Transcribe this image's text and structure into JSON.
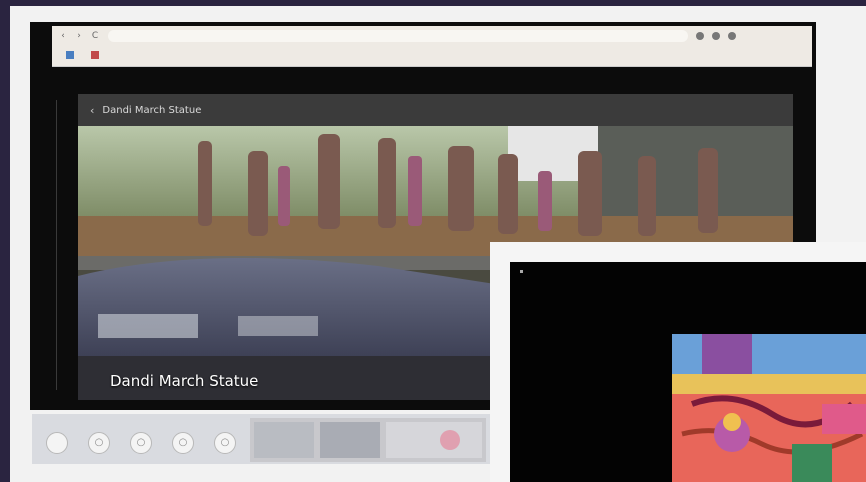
{
  "browser": {
    "nav": {
      "back": "‹",
      "forward": "›",
      "reload": "C"
    },
    "url": "",
    "bookmarks": [
      {
        "label": ""
      },
      {
        "label": ""
      }
    ]
  },
  "viewer": {
    "header_title": "Dandi March Statue",
    "back_icon": "chevron-left-icon",
    "photo_caption": "Dandi March Statue"
  },
  "filmstrip": {
    "controls": [
      {
        "icon": "circle-button-icon"
      },
      {
        "icon": "circle-button-icon"
      },
      {
        "icon": "circle-button-icon"
      },
      {
        "icon": "circle-button-icon"
      }
    ]
  },
  "pip": {
    "content": "colorful-painting"
  },
  "colors": {
    "desktop": "#2a2440",
    "viewer_bg": "#2a2a2a",
    "header_bg": "#3b3b3b",
    "browser_bar": "#eeeae4"
  }
}
